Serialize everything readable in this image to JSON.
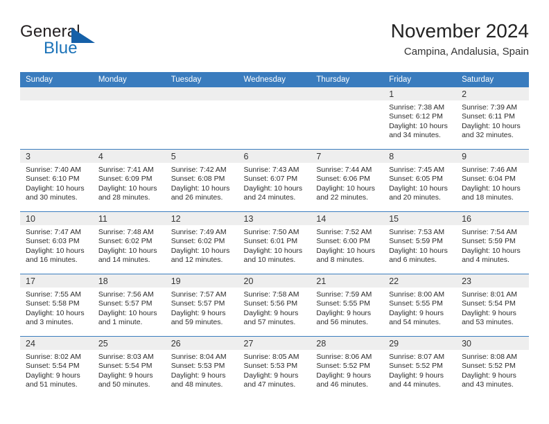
{
  "brand": {
    "general": "General",
    "blue": "Blue",
    "triangle_color": "#1560a8",
    "blue_color": "#1a72b8"
  },
  "header": {
    "month_title": "November 2024",
    "location": "Campina, Andalusia, Spain"
  },
  "theme": {
    "header_blue": "#3a7cbe",
    "date_band_gray": "#eeeeee",
    "cell_white": "#ffffff",
    "text": "#2b2b2b"
  },
  "weekday_headers": [
    "Sunday",
    "Monday",
    "Tuesday",
    "Wednesday",
    "Thursday",
    "Friday",
    "Saturday"
  ],
  "weeks": [
    [
      {
        "day": "",
        "lines": []
      },
      {
        "day": "",
        "lines": []
      },
      {
        "day": "",
        "lines": []
      },
      {
        "day": "",
        "lines": []
      },
      {
        "day": "",
        "lines": []
      },
      {
        "day": "1",
        "lines": [
          "Sunrise: 7:38 AM",
          "Sunset: 6:12 PM",
          "Daylight: 10 hours",
          "and 34 minutes."
        ]
      },
      {
        "day": "2",
        "lines": [
          "Sunrise: 7:39 AM",
          "Sunset: 6:11 PM",
          "Daylight: 10 hours",
          "and 32 minutes."
        ]
      }
    ],
    [
      {
        "day": "3",
        "lines": [
          "Sunrise: 7:40 AM",
          "Sunset: 6:10 PM",
          "Daylight: 10 hours",
          "and 30 minutes."
        ]
      },
      {
        "day": "4",
        "lines": [
          "Sunrise: 7:41 AM",
          "Sunset: 6:09 PM",
          "Daylight: 10 hours",
          "and 28 minutes."
        ]
      },
      {
        "day": "5",
        "lines": [
          "Sunrise: 7:42 AM",
          "Sunset: 6:08 PM",
          "Daylight: 10 hours",
          "and 26 minutes."
        ]
      },
      {
        "day": "6",
        "lines": [
          "Sunrise: 7:43 AM",
          "Sunset: 6:07 PM",
          "Daylight: 10 hours",
          "and 24 minutes."
        ]
      },
      {
        "day": "7",
        "lines": [
          "Sunrise: 7:44 AM",
          "Sunset: 6:06 PM",
          "Daylight: 10 hours",
          "and 22 minutes."
        ]
      },
      {
        "day": "8",
        "lines": [
          "Sunrise: 7:45 AM",
          "Sunset: 6:05 PM",
          "Daylight: 10 hours",
          "and 20 minutes."
        ]
      },
      {
        "day": "9",
        "lines": [
          "Sunrise: 7:46 AM",
          "Sunset: 6:04 PM",
          "Daylight: 10 hours",
          "and 18 minutes."
        ]
      }
    ],
    [
      {
        "day": "10",
        "lines": [
          "Sunrise: 7:47 AM",
          "Sunset: 6:03 PM",
          "Daylight: 10 hours",
          "and 16 minutes."
        ]
      },
      {
        "day": "11",
        "lines": [
          "Sunrise: 7:48 AM",
          "Sunset: 6:02 PM",
          "Daylight: 10 hours",
          "and 14 minutes."
        ]
      },
      {
        "day": "12",
        "lines": [
          "Sunrise: 7:49 AM",
          "Sunset: 6:02 PM",
          "Daylight: 10 hours",
          "and 12 minutes."
        ]
      },
      {
        "day": "13",
        "lines": [
          "Sunrise: 7:50 AM",
          "Sunset: 6:01 PM",
          "Daylight: 10 hours",
          "and 10 minutes."
        ]
      },
      {
        "day": "14",
        "lines": [
          "Sunrise: 7:52 AM",
          "Sunset: 6:00 PM",
          "Daylight: 10 hours",
          "and 8 minutes."
        ]
      },
      {
        "day": "15",
        "lines": [
          "Sunrise: 7:53 AM",
          "Sunset: 5:59 PM",
          "Daylight: 10 hours",
          "and 6 minutes."
        ]
      },
      {
        "day": "16",
        "lines": [
          "Sunrise: 7:54 AM",
          "Sunset: 5:59 PM",
          "Daylight: 10 hours",
          "and 4 minutes."
        ]
      }
    ],
    [
      {
        "day": "17",
        "lines": [
          "Sunrise: 7:55 AM",
          "Sunset: 5:58 PM",
          "Daylight: 10 hours",
          "and 3 minutes."
        ]
      },
      {
        "day": "18",
        "lines": [
          "Sunrise: 7:56 AM",
          "Sunset: 5:57 PM",
          "Daylight: 10 hours",
          "and 1 minute."
        ]
      },
      {
        "day": "19",
        "lines": [
          "Sunrise: 7:57 AM",
          "Sunset: 5:57 PM",
          "Daylight: 9 hours",
          "and 59 minutes."
        ]
      },
      {
        "day": "20",
        "lines": [
          "Sunrise: 7:58 AM",
          "Sunset: 5:56 PM",
          "Daylight: 9 hours",
          "and 57 minutes."
        ]
      },
      {
        "day": "21",
        "lines": [
          "Sunrise: 7:59 AM",
          "Sunset: 5:55 PM",
          "Daylight: 9 hours",
          "and 56 minutes."
        ]
      },
      {
        "day": "22",
        "lines": [
          "Sunrise: 8:00 AM",
          "Sunset: 5:55 PM",
          "Daylight: 9 hours",
          "and 54 minutes."
        ]
      },
      {
        "day": "23",
        "lines": [
          "Sunrise: 8:01 AM",
          "Sunset: 5:54 PM",
          "Daylight: 9 hours",
          "and 53 minutes."
        ]
      }
    ],
    [
      {
        "day": "24",
        "lines": [
          "Sunrise: 8:02 AM",
          "Sunset: 5:54 PM",
          "Daylight: 9 hours",
          "and 51 minutes."
        ]
      },
      {
        "day": "25",
        "lines": [
          "Sunrise: 8:03 AM",
          "Sunset: 5:54 PM",
          "Daylight: 9 hours",
          "and 50 minutes."
        ]
      },
      {
        "day": "26",
        "lines": [
          "Sunrise: 8:04 AM",
          "Sunset: 5:53 PM",
          "Daylight: 9 hours",
          "and 48 minutes."
        ]
      },
      {
        "day": "27",
        "lines": [
          "Sunrise: 8:05 AM",
          "Sunset: 5:53 PM",
          "Daylight: 9 hours",
          "and 47 minutes."
        ]
      },
      {
        "day": "28",
        "lines": [
          "Sunrise: 8:06 AM",
          "Sunset: 5:52 PM",
          "Daylight: 9 hours",
          "and 46 minutes."
        ]
      },
      {
        "day": "29",
        "lines": [
          "Sunrise: 8:07 AM",
          "Sunset: 5:52 PM",
          "Daylight: 9 hours",
          "and 44 minutes."
        ]
      },
      {
        "day": "30",
        "lines": [
          "Sunrise: 8:08 AM",
          "Sunset: 5:52 PM",
          "Daylight: 9 hours",
          "and 43 minutes."
        ]
      }
    ]
  ]
}
